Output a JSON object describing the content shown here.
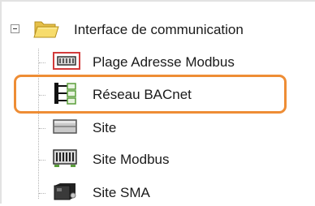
{
  "tree": {
    "root": {
      "label": "Interface de communication",
      "expanded": true,
      "icon": "folder-icon"
    },
    "children": [
      {
        "label": "Plage Adresse Modbus",
        "icon": "modbus-range-icon"
      },
      {
        "label": "Réseau BACnet",
        "icon": "bacnet-network-icon",
        "highlighted": true
      },
      {
        "label": "Site",
        "icon": "site-icon"
      },
      {
        "label": "Site Modbus",
        "icon": "modbus-site-icon"
      },
      {
        "label": "Site SMA",
        "icon": "sma-site-icon"
      }
    ]
  },
  "colors": {
    "highlight": "#ee8d35",
    "folder": "#f2d35c",
    "accent_red": "#d23b3b",
    "accent_green": "#5a9e3a"
  }
}
